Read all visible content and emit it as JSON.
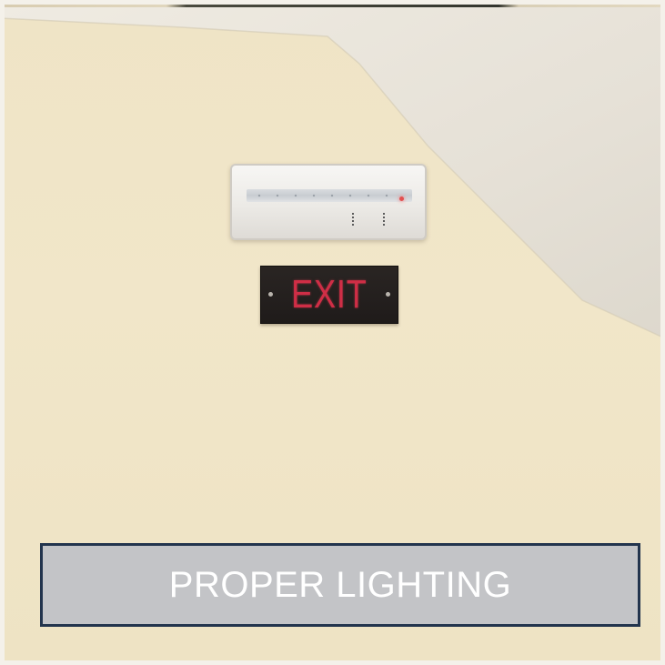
{
  "scene": {
    "description_colors": {
      "wall": "#f1e6c9",
      "ceiling": "#e9e4da",
      "sign_background": "#231e1c",
      "sign_text": "#cf2e46",
      "caption_background": "#c3c4c7",
      "caption_border": "#22344d",
      "caption_text": "#ffffff"
    }
  },
  "exit_sign": {
    "label": "EXIT"
  },
  "caption": {
    "text": "PROPER LIGHTING"
  },
  "icons": {
    "emergency_light": "emergency-light-fixture",
    "indicator": "red-indicator-led"
  }
}
